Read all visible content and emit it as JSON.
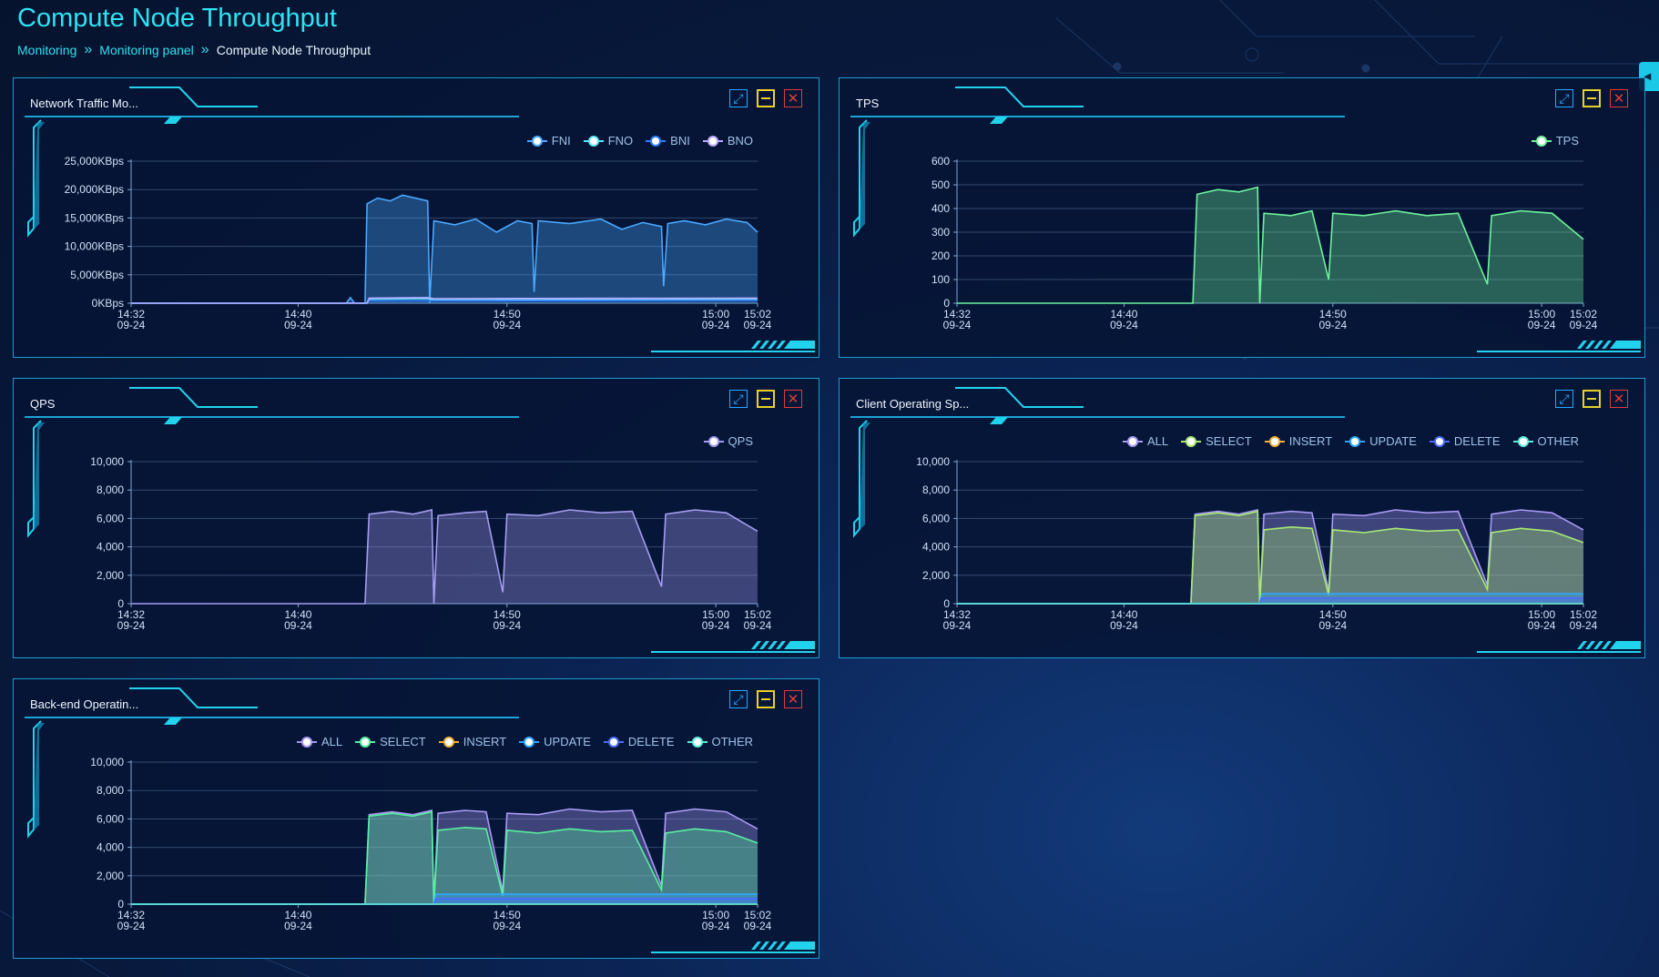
{
  "page": {
    "title": "Compute Node Throughput",
    "breadcrumb": [
      {
        "label": "Monitoring",
        "link": true
      },
      {
        "label": "Monitoring panel",
        "link": true
      },
      {
        "label": "Compute Node Throughput",
        "link": false
      }
    ],
    "breadcrumb_separator": "»"
  },
  "controls": {
    "expand_icon": "expand-icon",
    "minimize_icon": "minimize-icon",
    "close_icon": "close-icon",
    "side_toggle_icon": "collapse-arrow-icon"
  },
  "colors": {
    "accent": "#2fe3f3",
    "FNI": "#4aa8ff",
    "FNO": "#5be5ff",
    "BNI": "#2f7bff",
    "BNO": "#b7a8ff",
    "TPS": "#6df29b",
    "QPS": "#a59cf0",
    "ALL": "#a99af5",
    "SELECT": "#a8ea73",
    "INSERT": "#f2b03a",
    "UPDATE": "#2ea8ff",
    "DELETE": "#4a6cff",
    "OTHER": "#58f0d8"
  },
  "chart_data": [
    {
      "id": "network",
      "panel_title": "Network Traffic Mo...",
      "type": "area",
      "x_ticks": [
        "14:32\n09-24",
        "14:40\n09-24",
        "14:50\n09-24",
        "15:00\n09-24",
        "15:02\n09-24"
      ],
      "x_minutes": [
        0,
        8,
        18,
        28,
        30
      ],
      "y_ticks": [
        "0KBps",
        "5,000KBps",
        "10,000KBps",
        "15,000KBps",
        "20,000KBps",
        "25,000KBps"
      ],
      "ylim": [
        0,
        25000
      ],
      "series": [
        {
          "name": "FNI",
          "color": "#4aa8ff",
          "fill": true,
          "points": [
            [
              0,
              0
            ],
            [
              10.3,
              0
            ],
            [
              10.5,
              1000
            ],
            [
              10.7,
              0
            ],
            [
              11.2,
              0
            ],
            [
              11.3,
              17500
            ],
            [
              11.8,
              18500
            ],
            [
              12.4,
              18000
            ],
            [
              13,
              19000
            ],
            [
              14.2,
              18000
            ],
            [
              14.3,
              0
            ],
            [
              14.5,
              14500
            ],
            [
              15.5,
              13800
            ],
            [
              16.5,
              14800
            ],
            [
              17.5,
              12500
            ],
            [
              18.5,
              14500
            ],
            [
              19.2,
              14000
            ],
            [
              19.3,
              2000
            ],
            [
              19.5,
              14500
            ],
            [
              21,
              14000
            ],
            [
              22.5,
              14800
            ],
            [
              23.5,
              13000
            ],
            [
              24.5,
              14200
            ],
            [
              25.4,
              13500
            ],
            [
              25.5,
              3000
            ],
            [
              25.7,
              14000
            ],
            [
              26.5,
              14500
            ],
            [
              27.5,
              13800
            ],
            [
              28.5,
              14800
            ],
            [
              29.5,
              14200
            ],
            [
              30,
              12500
            ]
          ]
        },
        {
          "name": "FNO",
          "color": "#5be5ff",
          "fill": false,
          "points": [
            [
              0,
              0
            ],
            [
              11.3,
              0
            ],
            [
              11.4,
              700
            ],
            [
              14.2,
              800
            ],
            [
              14.5,
              600
            ],
            [
              30,
              700
            ]
          ]
        },
        {
          "name": "BNI",
          "color": "#2f7bff",
          "fill": false,
          "points": [
            [
              0,
              0
            ],
            [
              11.3,
              0
            ],
            [
              11.4,
              400
            ],
            [
              30,
              500
            ]
          ]
        },
        {
          "name": "BNO",
          "color": "#b7a8ff",
          "fill": false,
          "points": [
            [
              0,
              0
            ],
            [
              11.3,
              0
            ],
            [
              11.4,
              900
            ],
            [
              14.2,
              1000
            ],
            [
              14.5,
              800
            ],
            [
              30,
              900
            ]
          ]
        }
      ]
    },
    {
      "id": "tps",
      "panel_title": "TPS",
      "type": "area",
      "x_ticks": [
        "14:32\n09-24",
        "14:40\n09-24",
        "14:50\n09-24",
        "15:00\n09-24",
        "15:02\n09-24"
      ],
      "x_minutes": [
        0,
        8,
        18,
        28,
        30
      ],
      "y_ticks": [
        "0",
        "100",
        "200",
        "300",
        "400",
        "500",
        "600"
      ],
      "ylim": [
        0,
        600
      ],
      "series": [
        {
          "name": "TPS",
          "color": "#6df29b",
          "fill": true,
          "points": [
            [
              0,
              0
            ],
            [
              11.3,
              0
            ],
            [
              11.5,
              460
            ],
            [
              12.5,
              480
            ],
            [
              13.5,
              470
            ],
            [
              14.4,
              490
            ],
            [
              14.5,
              0
            ],
            [
              14.7,
              380
            ],
            [
              16,
              370
            ],
            [
              17,
              390
            ],
            [
              17.8,
              100
            ],
            [
              18,
              380
            ],
            [
              19.5,
              370
            ],
            [
              21,
              390
            ],
            [
              22.5,
              370
            ],
            [
              24,
              380
            ],
            [
              25.4,
              80
            ],
            [
              25.6,
              370
            ],
            [
              27,
              390
            ],
            [
              28.5,
              380
            ],
            [
              30,
              270
            ]
          ]
        }
      ]
    },
    {
      "id": "qps",
      "panel_title": "QPS",
      "type": "area",
      "x_ticks": [
        "14:32\n09-24",
        "14:40\n09-24",
        "14:50\n09-24",
        "15:00\n09-24",
        "15:02\n09-24"
      ],
      "x_minutes": [
        0,
        8,
        18,
        28,
        30
      ],
      "y_ticks": [
        "0",
        "2,000",
        "4,000",
        "6,000",
        "8,000",
        "10,000"
      ],
      "ylim": [
        0,
        10000
      ],
      "series": [
        {
          "name": "QPS",
          "color": "#a59cf0",
          "fill": true,
          "points": [
            [
              0,
              0
            ],
            [
              11.2,
              0
            ],
            [
              11.4,
              6300
            ],
            [
              12.5,
              6500
            ],
            [
              13.5,
              6300
            ],
            [
              14.4,
              6600
            ],
            [
              14.5,
              0
            ],
            [
              14.7,
              6200
            ],
            [
              16,
              6400
            ],
            [
              17,
              6500
            ],
            [
              17.8,
              800
            ],
            [
              18,
              6300
            ],
            [
              19.5,
              6200
            ],
            [
              21,
              6600
            ],
            [
              22.5,
              6400
            ],
            [
              24,
              6500
            ],
            [
              25.4,
              1200
            ],
            [
              25.6,
              6300
            ],
            [
              27,
              6600
            ],
            [
              28.5,
              6400
            ],
            [
              30,
              5100
            ]
          ]
        }
      ]
    },
    {
      "id": "client",
      "panel_title": "Client Operating Sp...",
      "type": "area",
      "x_ticks": [
        "14:32\n09-24",
        "14:40\n09-24",
        "14:50\n09-24",
        "15:00\n09-24",
        "15:02\n09-24"
      ],
      "x_minutes": [
        0,
        8,
        18,
        28,
        30
      ],
      "y_ticks": [
        "0",
        "2,000",
        "4,000",
        "6,000",
        "8,000",
        "10,000"
      ],
      "ylim": [
        0,
        10000
      ],
      "series": [
        {
          "name": "ALL",
          "color": "#a99af5",
          "fill": true,
          "points": [
            [
              0,
              0
            ],
            [
              11.2,
              0
            ],
            [
              11.4,
              6300
            ],
            [
              12.5,
              6500
            ],
            [
              13.5,
              6300
            ],
            [
              14.4,
              6600
            ],
            [
              14.5,
              0
            ],
            [
              14.7,
              6300
            ],
            [
              16,
              6500
            ],
            [
              17,
              6400
            ],
            [
              17.8,
              900
            ],
            [
              18,
              6300
            ],
            [
              19.5,
              6200
            ],
            [
              21,
              6600
            ],
            [
              22.5,
              6400
            ],
            [
              24,
              6500
            ],
            [
              25.4,
              1300
            ],
            [
              25.6,
              6300
            ],
            [
              27,
              6600
            ],
            [
              28.5,
              6400
            ],
            [
              30,
              5200
            ]
          ]
        },
        {
          "name": "SELECT",
          "color": "#a8ea73",
          "fill": true,
          "points": [
            [
              0,
              0
            ],
            [
              11.2,
              0
            ],
            [
              11.4,
              6200
            ],
            [
              12.5,
              6400
            ],
            [
              13.5,
              6200
            ],
            [
              14.4,
              6500
            ],
            [
              14.5,
              0
            ],
            [
              14.7,
              5200
            ],
            [
              16,
              5400
            ],
            [
              17,
              5300
            ],
            [
              17.8,
              600
            ],
            [
              18,
              5200
            ],
            [
              19.5,
              5000
            ],
            [
              21,
              5300
            ],
            [
              22.5,
              5100
            ],
            [
              24,
              5200
            ],
            [
              25.4,
              1000
            ],
            [
              25.6,
              5000
            ],
            [
              27,
              5300
            ],
            [
              28.5,
              5100
            ],
            [
              30,
              4300
            ]
          ]
        },
        {
          "name": "INSERT",
          "color": "#f2b03a",
          "fill": false,
          "points": [
            [
              0,
              0
            ],
            [
              30,
              0
            ]
          ]
        },
        {
          "name": "UPDATE",
          "color": "#2ea8ff",
          "fill": true,
          "points": [
            [
              0,
              0
            ],
            [
              14.5,
              0
            ],
            [
              14.6,
              700
            ],
            [
              30,
              700
            ]
          ]
        },
        {
          "name": "DELETE",
          "color": "#4a6cff",
          "fill": true,
          "points": [
            [
              0,
              0
            ],
            [
              14.5,
              0
            ],
            [
              14.6,
              400
            ],
            [
              30,
              400
            ]
          ]
        },
        {
          "name": "OTHER",
          "color": "#58f0d8",
          "fill": false,
          "points": [
            [
              0,
              0
            ],
            [
              30,
              0
            ]
          ]
        }
      ]
    },
    {
      "id": "backend",
      "panel_title": "Back-end Operatin...",
      "type": "area",
      "x_ticks": [
        "14:32\n09-24",
        "14:40\n09-24",
        "14:50\n09-24",
        "15:00\n09-24",
        "15:02\n09-24"
      ],
      "x_minutes": [
        0,
        8,
        18,
        28,
        30
      ],
      "y_ticks": [
        "0",
        "2,000",
        "4,000",
        "6,000",
        "8,000",
        "10,000"
      ],
      "ylim": [
        0,
        10000
      ],
      "series": [
        {
          "name": "ALL",
          "color": "#a99af5",
          "fill": true,
          "points": [
            [
              0,
              0
            ],
            [
              11.2,
              0
            ],
            [
              11.4,
              6300
            ],
            [
              12.5,
              6500
            ],
            [
              13.5,
              6300
            ],
            [
              14.4,
              6600
            ],
            [
              14.5,
              0
            ],
            [
              14.7,
              6400
            ],
            [
              16,
              6600
            ],
            [
              17,
              6500
            ],
            [
              17.8,
              900
            ],
            [
              18,
              6400
            ],
            [
              19.5,
              6300
            ],
            [
              21,
              6700
            ],
            [
              22.5,
              6500
            ],
            [
              24,
              6600
            ],
            [
              25.4,
              1300
            ],
            [
              25.6,
              6400
            ],
            [
              27,
              6700
            ],
            [
              28.5,
              6500
            ],
            [
              30,
              5300
            ]
          ]
        },
        {
          "name": "SELECT",
          "color": "#58f0a0",
          "fill": true,
          "points": [
            [
              0,
              0
            ],
            [
              11.2,
              0
            ],
            [
              11.4,
              6200
            ],
            [
              12.5,
              6400
            ],
            [
              13.5,
              6200
            ],
            [
              14.4,
              6500
            ],
            [
              14.5,
              0
            ],
            [
              14.7,
              5200
            ],
            [
              16,
              5400
            ],
            [
              17,
              5300
            ],
            [
              17.8,
              600
            ],
            [
              18,
              5200
            ],
            [
              19.5,
              5000
            ],
            [
              21,
              5300
            ],
            [
              22.5,
              5100
            ],
            [
              24,
              5200
            ],
            [
              25.4,
              1000
            ],
            [
              25.6,
              5000
            ],
            [
              27,
              5300
            ],
            [
              28.5,
              5100
            ],
            [
              30,
              4300
            ]
          ]
        },
        {
          "name": "INSERT",
          "color": "#f2b03a",
          "fill": false,
          "points": [
            [
              0,
              0
            ],
            [
              30,
              0
            ]
          ]
        },
        {
          "name": "UPDATE",
          "color": "#2ea8ff",
          "fill": true,
          "points": [
            [
              0,
              0
            ],
            [
              14.5,
              0
            ],
            [
              14.6,
              700
            ],
            [
              30,
              700
            ]
          ]
        },
        {
          "name": "DELETE",
          "color": "#4a6cff",
          "fill": true,
          "points": [
            [
              0,
              0
            ],
            [
              14.5,
              0
            ],
            [
              14.6,
              400
            ],
            [
              30,
              400
            ]
          ]
        },
        {
          "name": "OTHER",
          "color": "#58f0d8",
          "fill": false,
          "points": [
            [
              0,
              0
            ],
            [
              30,
              0
            ]
          ]
        }
      ]
    }
  ]
}
